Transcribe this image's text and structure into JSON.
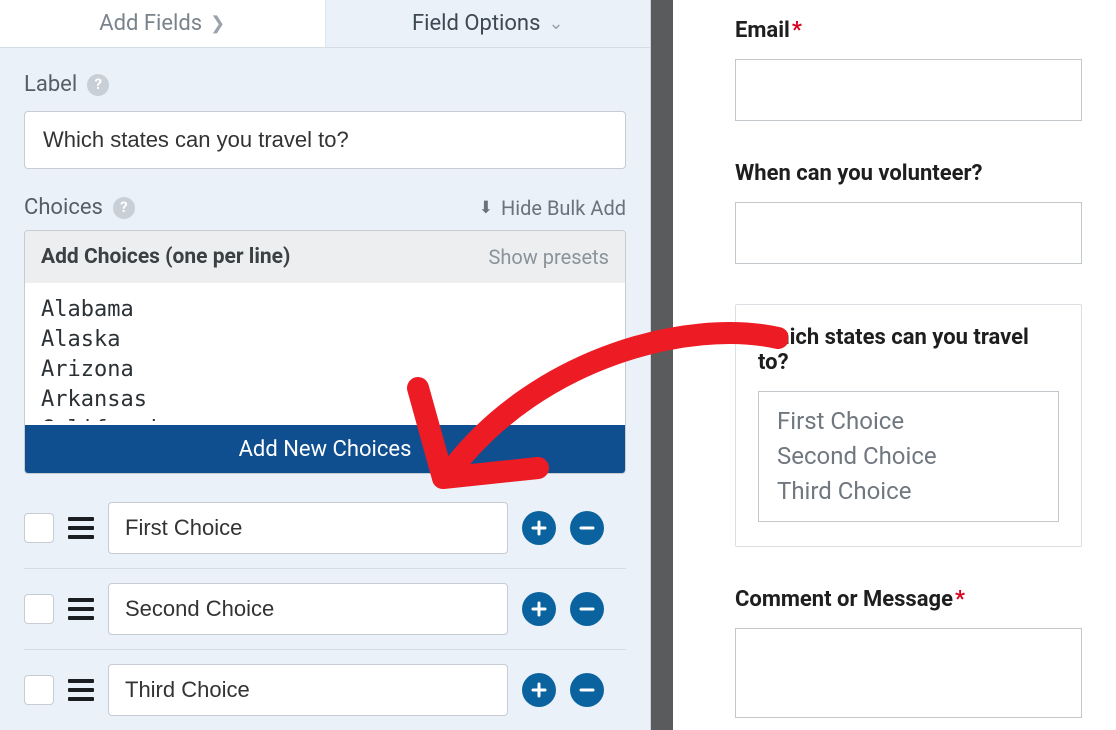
{
  "tabs": {
    "add_fields": "Add Fields",
    "field_options": "Field Options"
  },
  "label_section": {
    "title": "Label",
    "value": "Which states can you travel to?"
  },
  "choices_section": {
    "title": "Choices",
    "hide_bulk": "Hide Bulk Add",
    "bulk_title": "Add Choices (one per line)",
    "show_presets": "Show presets",
    "bulk_text": "Alabama\nAlaska\nArizona\nArkansas\nCalifornia",
    "add_button": "Add New Choices",
    "items": [
      {
        "label": "First Choice"
      },
      {
        "label": "Second Choice"
      },
      {
        "label": "Third Choice"
      }
    ]
  },
  "preview": {
    "email_label": "Email",
    "volunteer_label": "When can you volunteer?",
    "states_label": "Which states can you travel to?",
    "options": [
      "First Choice",
      "Second Choice",
      "Third Choice"
    ],
    "comment_label": "Comment or Message"
  }
}
